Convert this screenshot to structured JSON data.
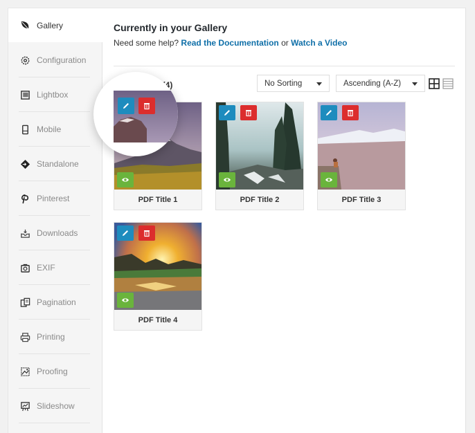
{
  "sidebar": {
    "items": [
      {
        "label": "Gallery",
        "icon": "leaf-icon",
        "active": true
      },
      {
        "label": "Configuration",
        "icon": "gear-icon"
      },
      {
        "label": "Lightbox",
        "icon": "lightbox-icon"
      },
      {
        "label": "Mobile",
        "icon": "mobile-icon"
      },
      {
        "label": "Standalone",
        "icon": "standalone-icon"
      },
      {
        "label": "Pinterest",
        "icon": "pinterest-icon"
      },
      {
        "label": "Downloads",
        "icon": "download-icon"
      },
      {
        "label": "EXIF",
        "icon": "camera-icon"
      },
      {
        "label": "Pagination",
        "icon": "pagination-icon"
      },
      {
        "label": "Printing",
        "icon": "printer-icon"
      },
      {
        "label": "Proofing",
        "icon": "proofing-icon"
      },
      {
        "label": "Slideshow",
        "icon": "slideshow-icon"
      }
    ]
  },
  "main": {
    "title": "Currently in your Gallery",
    "help_prefix": "Need some help?",
    "doc_link": "Read the Documentation",
    "or_text": "or",
    "video_link": "Watch a Video",
    "count_label": "l (4)",
    "sort_select": {
      "value": "No Sorting"
    },
    "order_select": {
      "value": "Ascending (A-Z)"
    },
    "view_modes": [
      "grid-view",
      "list-view"
    ],
    "items": [
      {
        "title": "PDF Title 1"
      },
      {
        "title": "PDF Title 2"
      },
      {
        "title": "PDF Title 3"
      },
      {
        "title": "PDF Title 4"
      }
    ]
  },
  "colors": {
    "edit": "#1e8cbe",
    "delete": "#dc2d2d",
    "view": "#6ab43c",
    "link": "#0f6fa8"
  }
}
